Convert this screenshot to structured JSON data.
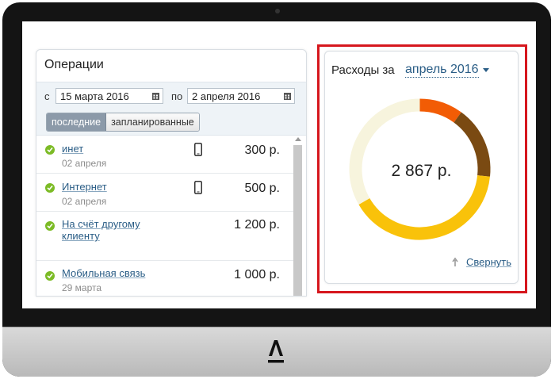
{
  "operations": {
    "title": "Операции",
    "filter": {
      "from_label": "с",
      "from_date": "15 марта 2016",
      "to_label": "по",
      "to_date": "2 апреля 2016"
    },
    "tabs": [
      {
        "label": "последние",
        "active": true
      },
      {
        "label": "запланированные",
        "active": false
      }
    ],
    "items": [
      {
        "title": "инет",
        "date": "02 апреля",
        "amount": "300 р.",
        "icon": "phone-icon"
      },
      {
        "title": "Интернет",
        "date": "02 апреля",
        "amount": "500 р.",
        "icon": "phone-icon"
      },
      {
        "title": "На счёт другому клиенту",
        "date": "",
        "amount": "1 200 р.",
        "icon": ""
      },
      {
        "title": "Мобильная связь",
        "date": "29 марта",
        "amount": "1 000 р.",
        "icon": ""
      }
    ]
  },
  "expenses": {
    "title": "Расходы за",
    "month": "апрель 2016",
    "total": "2 867 р.",
    "collapse_label": "Свернуть"
  },
  "chart_data": {
    "type": "pie",
    "values": [
      300,
      500,
      1200,
      1000
    ],
    "total": 2867,
    "colors": [
      "#f25c05",
      "#7a4a12",
      "#f9c20a",
      "#f7f4dd"
    ]
  },
  "colors": {
    "link": "#2a5d86",
    "success": "#7cbb26",
    "highlight": "#d6161d"
  }
}
